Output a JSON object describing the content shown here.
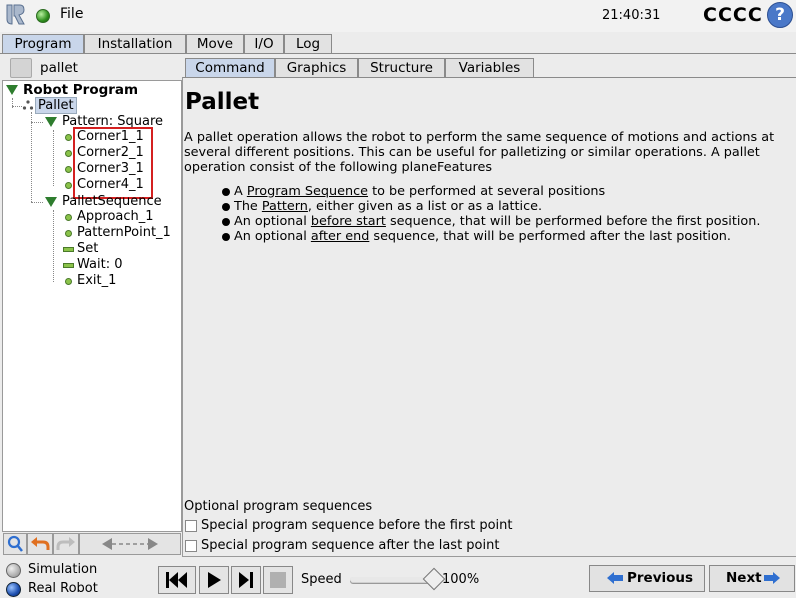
{
  "header": {
    "file_menu": "File",
    "clock": "21:40:31",
    "robot_name": "CCCC",
    "help_icon": "?"
  },
  "main_tabs": [
    "Program",
    "Installation",
    "Move",
    "I/O",
    "Log"
  ],
  "program_name": "pallet",
  "tree": {
    "root": "Robot Program",
    "pallet": "Pallet",
    "pattern": "Pattern: Square",
    "corners": [
      "Corner1_1",
      "Corner2_1",
      "Corner3_1",
      "Corner4_1"
    ],
    "sequence": "PalletSequence",
    "sequence_items": [
      "Approach_1",
      "PatternPoint_1",
      "Set",
      "Wait: 0",
      "Exit_1"
    ]
  },
  "sub_tabs": [
    "Command",
    "Graphics",
    "Structure",
    "Variables"
  ],
  "content": {
    "title": "Pallet",
    "description": "A pallet operation allows the robot to perform the same sequence of motions and actions at several different positions. This can be useful for palletizing or similar operations. A pallet operation consist of the following planeFeatures",
    "bullets": [
      {
        "pre": "A ",
        "link": "Program Sequence",
        "post": " to be performed at several positions"
      },
      {
        "pre": "The ",
        "link": "Pattern",
        "post": ", either given as a list or as a lattice."
      },
      {
        "pre": "An optional ",
        "link": "before start",
        "post": " sequence, that will be performed before the first position."
      },
      {
        "pre": "An optional ",
        "link": "after end",
        "post": " sequence, that will be performed after the last position."
      }
    ],
    "optional_label": "Optional program sequences",
    "checkbox_before": "Special program sequence before the first point",
    "checkbox_after": "Special program sequence after the last point"
  },
  "bottom": {
    "mode_simulation": "Simulation",
    "mode_real": "Real Robot",
    "speed_label": "Speed",
    "speed_value": "100%",
    "speed_fraction": 0.96,
    "previous_label": "Previous",
    "next_label": "Next"
  },
  "colors": {
    "active_tab": "#c9d6ea",
    "tree_triangle": "#2e7d2e",
    "highlight": "#d42020",
    "arrow_blue": "#2f6fd0"
  }
}
